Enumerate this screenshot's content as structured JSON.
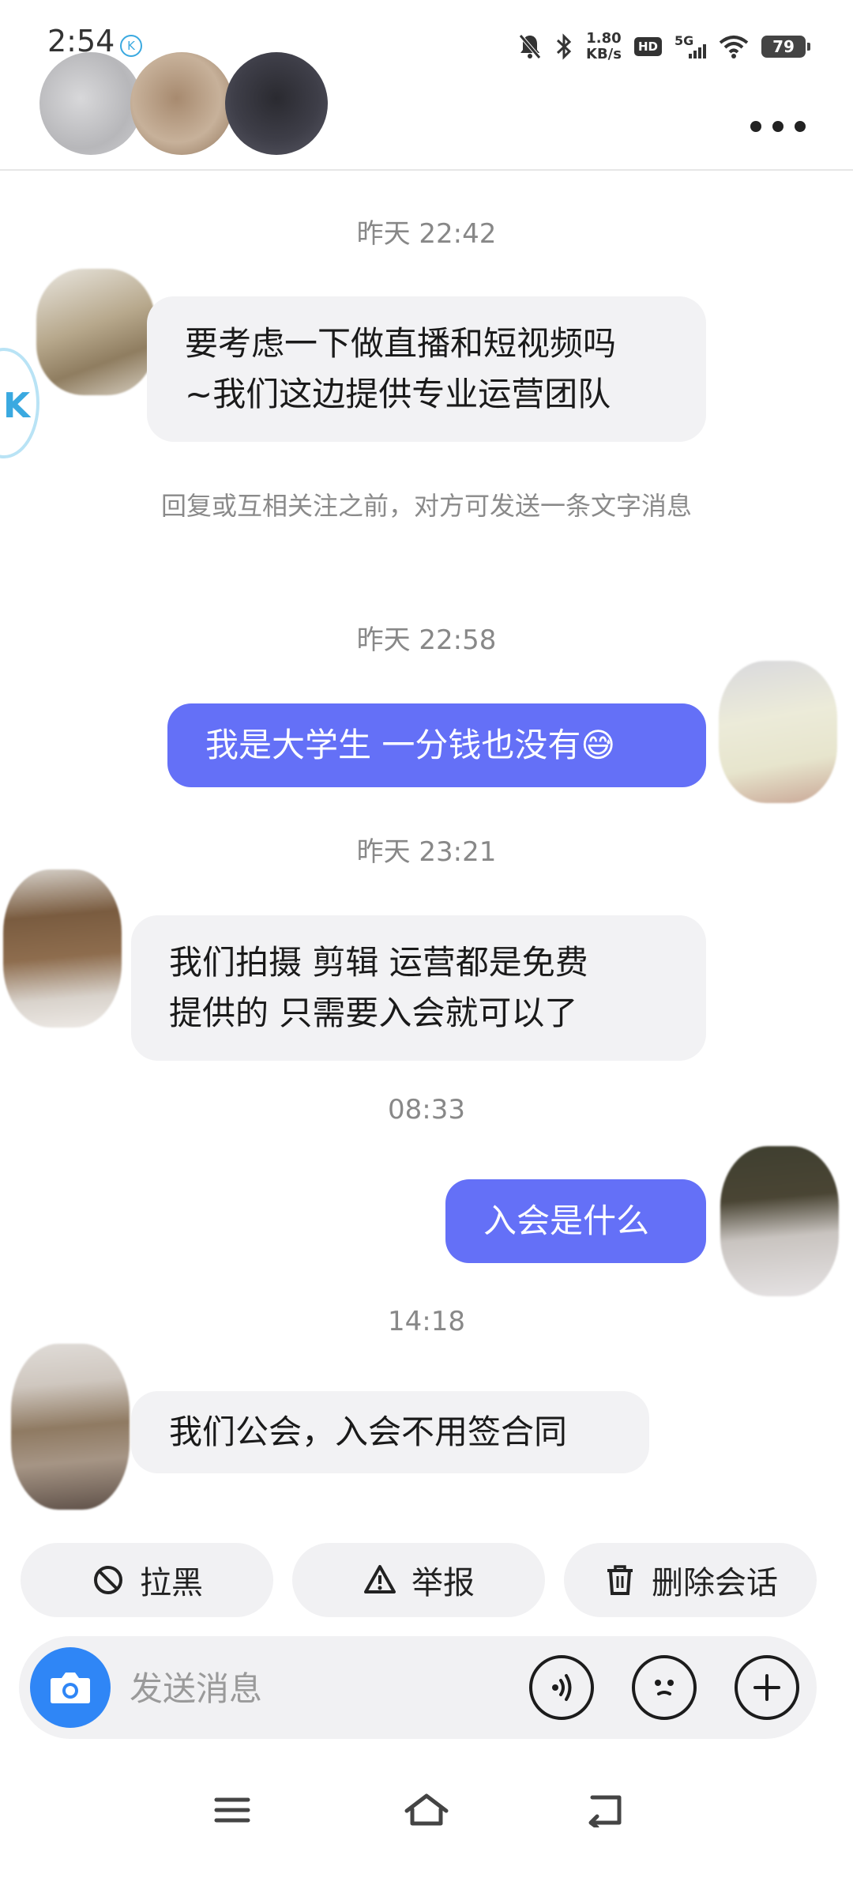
{
  "status_bar": {
    "time": "2:54",
    "app_badge": "K",
    "net_speed_value": "1.80",
    "net_speed_unit": "KB/s",
    "hd": "HD",
    "signal": "5G",
    "battery": "79"
  },
  "messages": [
    {
      "timestamp": "昨天 22:42"
    },
    {
      "incoming_text": [
        "要考虑一下做直播和短视频吗",
        "~我们这边提供专业运营团队"
      ]
    },
    {
      "notice": "回复或互相关注之前，对方可发送一条文字消息"
    },
    {
      "timestamp": "昨天 22:58"
    },
    {
      "outgoing_text": "我是大学生 一分钱也没有😅"
    },
    {
      "timestamp": "昨天 23:21"
    },
    {
      "incoming_text": [
        "我们拍摄 剪辑 运营都是免费",
        "提供的 只需要入会就可以了"
      ]
    },
    {
      "timestamp": "08:33"
    },
    {
      "outgoing_text": "入会是什么"
    },
    {
      "timestamp": "14:18"
    },
    {
      "incoming_text": [
        "我们公会，入会不用签合同"
      ]
    }
  ],
  "actions": {
    "block": "拉黑",
    "report": "举报",
    "delete": "删除会话"
  },
  "input": {
    "placeholder": "发送消息"
  },
  "icons": {
    "more": "more-icon",
    "camera": "camera-icon",
    "voice": "voice-icon",
    "emoji": "emoji-icon",
    "plus": "plus-icon"
  },
  "colors": {
    "accent": "#6470f7",
    "camera": "#2f86f6"
  }
}
